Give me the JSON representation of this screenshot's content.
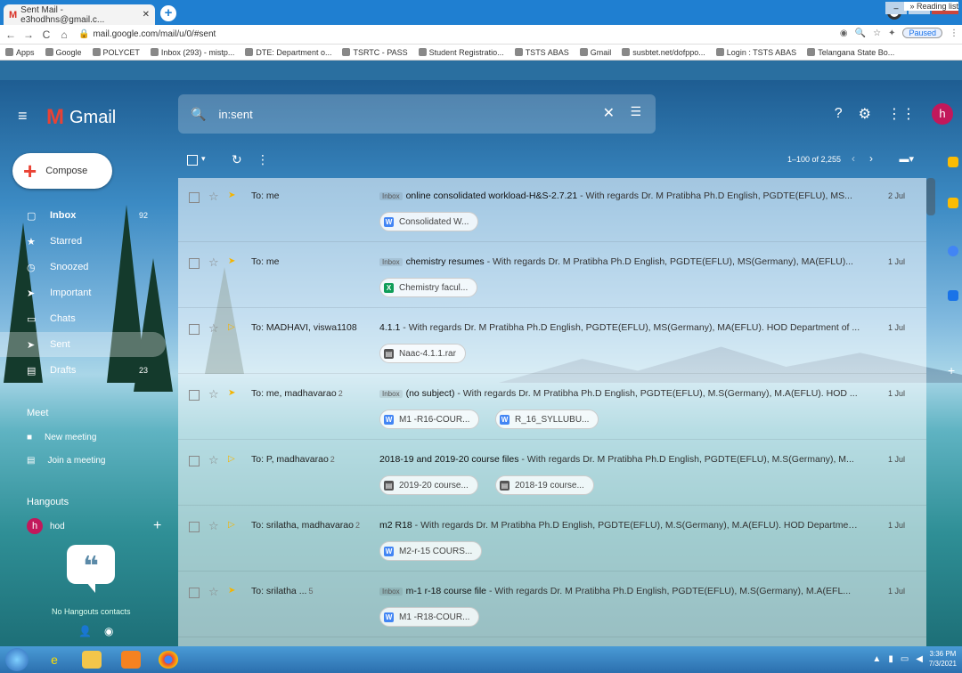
{
  "browser": {
    "tab_title": "Sent Mail - e3hodhns@gmail.c...",
    "tab_close": "✕",
    "new_tab": "+",
    "url": "mail.google.com/mail/u/0/#sent",
    "profile_status": "Paused",
    "bookmarks": [
      "Apps",
      "Google",
      "POLYCET",
      "Inbox (293) - mistp...",
      "DTE: Department o...",
      "TSRTC - PASS",
      "Student Registratio...",
      "TSTS ABAS",
      "Gmail",
      "susbtet.net/dofppo...",
      "Login : TSTS ABAS",
      "Telangana State Bo..."
    ],
    "bookmarks_more": "»",
    "reading_list": "Reading list"
  },
  "gmail": {
    "app_name": "Gmail",
    "search_value": "in:sent",
    "compose_label": "Compose",
    "nav": [
      {
        "label": "Inbox",
        "count": "92",
        "icon": "inbox-icon"
      },
      {
        "label": "Starred",
        "count": "",
        "icon": "star-icon"
      },
      {
        "label": "Snoozed",
        "count": "",
        "icon": "clock-icon"
      },
      {
        "label": "Important",
        "count": "",
        "icon": "label-icon"
      },
      {
        "label": "Chats",
        "count": "",
        "icon": "chat-icon"
      },
      {
        "label": "Sent",
        "count": "",
        "icon": "send-icon"
      },
      {
        "label": "Drafts",
        "count": "23",
        "icon": "draft-icon"
      }
    ],
    "meet_title": "Meet",
    "meet_items": [
      "New meeting",
      "Join a meeting"
    ],
    "hangouts_title": "Hangouts",
    "hangouts_user": "hod",
    "hangouts_user_initial": "h",
    "no_contacts": "No Hangouts contacts",
    "avatar_initial": "h",
    "pagination": "1–100 of 2,255",
    "emails": [
      {
        "to": "To: me",
        "count": "",
        "inbox_tag": "Inbox",
        "subject": "online consolidated workload-H&S-2.7.21",
        "snippet": " - With regards Dr. M Pratibha Ph.D English, PGDTE(EFLU), MS...",
        "date": "2 Jul",
        "attachments": [
          {
            "name": "Consolidated W...",
            "type": "w"
          }
        ]
      },
      {
        "to": "To: me",
        "count": "",
        "inbox_tag": "Inbox",
        "subject": "chemistry resumes",
        "snippet": " - With regards Dr. M Pratibha Ph.D English, PGDTE(EFLU), MS(Germany), MA(EFLU)...",
        "date": "1 Jul",
        "attachments": [
          {
            "name": "Chemistry facul...",
            "type": "x"
          }
        ]
      },
      {
        "to": "To: MADHAVI, viswa1108",
        "count": "",
        "inbox_tag": "",
        "subject": "4.1.1",
        "snippet": " - With regards Dr. M Pratibha Ph.D English, PGDTE(EFLU), MS(Germany), MA(EFLU). HOD Department of ...",
        "date": "1 Jul",
        "attachments": [
          {
            "name": "Naac-4.1.1.rar",
            "type": "r"
          }
        ]
      },
      {
        "to": "To: me, madhavarao",
        "count": "2",
        "inbox_tag": "Inbox",
        "subject": "(no subject)",
        "snippet": " - With regards Dr. M Pratibha Ph.D English, PGDTE(EFLU), M.S(Germany), M.A(EFLU). HOD ...",
        "date": "1 Jul",
        "attachments": [
          {
            "name": "M1 -R16-COUR...",
            "type": "w"
          },
          {
            "name": "R_16_SYLLUBU...",
            "type": "w"
          }
        ]
      },
      {
        "to": "To: P, madhavarao",
        "count": "2",
        "inbox_tag": "",
        "subject": "2018-19 and 2019-20 course files",
        "snippet": " - With regards Dr. M Pratibha Ph.D English, PGDTE(EFLU), M.S(Germany), M...",
        "date": "1 Jul",
        "attachments": [
          {
            "name": "2019-20 course...",
            "type": "r"
          },
          {
            "name": "2018-19 course...",
            "type": "r"
          }
        ]
      },
      {
        "to": "To: srilatha, madhavarao",
        "count": "2",
        "inbox_tag": "",
        "subject": "m2 R18",
        "snippet": " - With regards Dr. M Pratibha Ph.D English, PGDTE(EFLU), M.S(Germany), M.A(EFLU). HOD Departmen...",
        "date": "1 Jul",
        "attachments": [
          {
            "name": "M2-r-15 COURS...",
            "type": "w"
          }
        ]
      },
      {
        "to": "To: srilatha ...",
        "count": "5",
        "inbox_tag": "Inbox",
        "subject": "m-1 r-18 course file",
        "snippet": " - With regards Dr. M Pratibha Ph.D English, PGDTE(EFLU), M.S(Germany), M.A(EFL...",
        "date": "1 Jul",
        "attachments": [
          {
            "name": "M1 -R18-COUR...",
            "type": "w"
          }
        ]
      }
    ]
  },
  "taskbar": {
    "time": "3:36 PM",
    "date": "7/3/2021"
  },
  "colors": {
    "accent": "#1a73e8",
    "gmail_red": "#ea4335",
    "avatar": "#c2185b"
  }
}
